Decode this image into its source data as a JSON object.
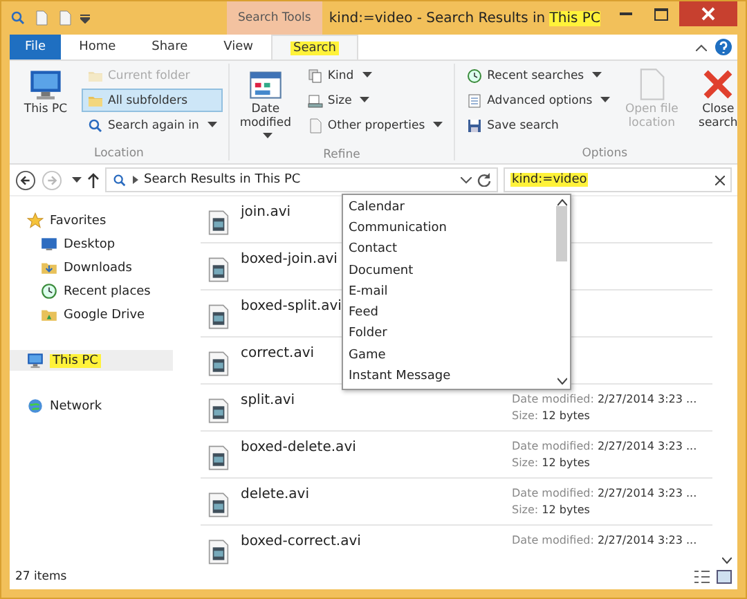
{
  "window": {
    "title_parts": [
      {
        "text": "kind:=video - Search Results in ",
        "highlighted": false
      },
      {
        "text": "This PC",
        "highlighted": true
      }
    ],
    "context_label": "Search Tools"
  },
  "tabs": [
    {
      "label": "File",
      "kind": "file",
      "selected": false,
      "highlighted": false
    },
    {
      "label": "Home",
      "kind": "tab",
      "selected": false,
      "highlighted": false
    },
    {
      "label": "Share",
      "kind": "tab",
      "selected": false,
      "highlighted": false
    },
    {
      "label": "View",
      "kind": "tab",
      "selected": false,
      "highlighted": false
    },
    {
      "label": "Search",
      "kind": "tab",
      "selected": true,
      "highlighted": true
    }
  ],
  "ribbon": {
    "groups": [
      {
        "name": "Location",
        "big": [
          {
            "label": "This PC",
            "disabled": false,
            "dropdown": false
          }
        ],
        "small": [
          {
            "label": "Current folder",
            "disabled": true,
            "selected": false,
            "dropdown": false
          },
          {
            "label": "All subfolders",
            "disabled": false,
            "selected": true,
            "dropdown": false
          },
          {
            "label": "Search again in",
            "disabled": false,
            "selected": false,
            "dropdown": true
          }
        ]
      },
      {
        "name": "Refine",
        "big": [
          {
            "label": "Date modified",
            "disabled": false,
            "dropdown": true
          }
        ],
        "small": [
          {
            "label": "Kind",
            "disabled": false,
            "selected": false,
            "dropdown": true
          },
          {
            "label": "Size",
            "disabled": false,
            "selected": false,
            "dropdown": true
          },
          {
            "label": "Other properties",
            "disabled": false,
            "selected": false,
            "dropdown": true
          }
        ]
      },
      {
        "name": "Options",
        "small": [
          {
            "label": "Recent searches",
            "disabled": false,
            "selected": false,
            "dropdown": true
          },
          {
            "label": "Advanced options",
            "disabled": false,
            "selected": false,
            "dropdown": true
          },
          {
            "label": "Save search",
            "disabled": false,
            "selected": false,
            "dropdown": false
          }
        ],
        "big": [
          {
            "label": "Open file location",
            "disabled": true,
            "dropdown": false
          },
          {
            "label": "Close search",
            "disabled": false,
            "dropdown": false
          }
        ]
      }
    ]
  },
  "address_bar": {
    "path": "Search Results in This PC",
    "forward_disabled": true
  },
  "search": {
    "value": "kind:=video",
    "highlighted": true
  },
  "sidebar": {
    "sections": [
      {
        "label": "Favorites",
        "selected": false,
        "highlighted": false,
        "children": [
          {
            "label": "Desktop"
          },
          {
            "label": "Downloads"
          },
          {
            "label": "Recent places"
          },
          {
            "label": "Google Drive"
          }
        ]
      },
      {
        "label": "This PC",
        "selected": true,
        "highlighted": true
      },
      {
        "label": "Network",
        "selected": false,
        "highlighted": false
      }
    ]
  },
  "files": [
    {
      "name": "join.avi"
    },
    {
      "name": "boxed-join.avi"
    },
    {
      "name": "boxed-split.avi"
    },
    {
      "name": "correct.avi"
    },
    {
      "name": "split.avi",
      "date_label": "Date modified:",
      "date": "2/27/2014 3:23 ...",
      "size_label": "Size:",
      "size": "12 bytes"
    },
    {
      "name": "boxed-delete.avi",
      "date_label": "Date modified:",
      "date": "2/27/2014 3:23 ...",
      "size_label": "Size:",
      "size": "12 bytes"
    },
    {
      "name": "delete.avi",
      "date_label": "Date modified:",
      "date": "2/27/2014 3:23 ...",
      "size_label": "Size:",
      "size": "12 bytes"
    },
    {
      "name": "boxed-correct.avi",
      "date_label": "Date modified:",
      "date": "2/27/2014 3:23 ..."
    }
  ],
  "kind_dropdown": {
    "items": [
      "Calendar",
      "Communication",
      "Contact",
      "Document",
      "E-mail",
      "Feed",
      "Folder",
      "Game",
      "Instant Message"
    ]
  },
  "status_bar": {
    "count": "27 items"
  }
}
